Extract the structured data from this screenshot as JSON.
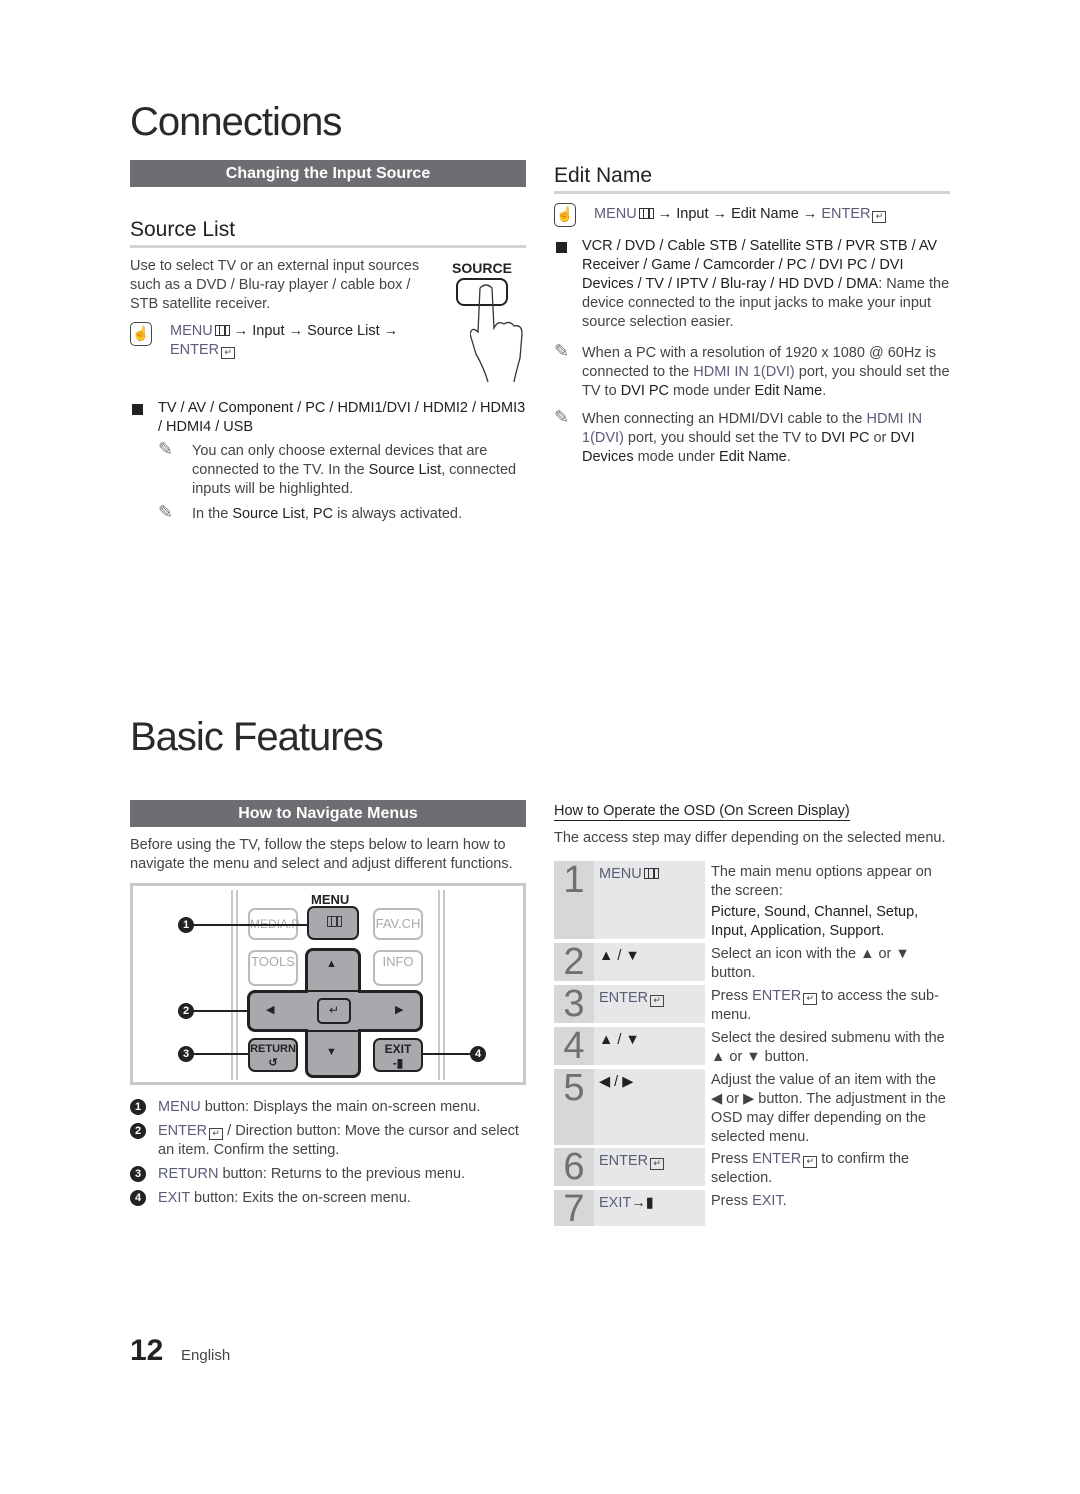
{
  "connections": {
    "title": "Connections",
    "bar_title": "Changing the Input Source",
    "source_list": {
      "heading": "Source List",
      "intro": "Use to select TV or an external input sources such as a DVD / Blu-ray player / cable box / STB satellite receiver.",
      "source_label": "SOURCE",
      "path_menu": "MENU",
      "path_rest": "→ Input → Source List →",
      "path_enter": "ENTER",
      "bullet": "TV / AV / Component / PC / HDMI1/DVI / HDMI2 / HDMI3 / HDMI4 / USB",
      "note1_a": "You can only choose external devices that are connected to the TV. In the ",
      "note1_b": "Source List",
      "note1_c": ", connected inputs will be highlighted.",
      "note2_a": "In the ",
      "note2_b": "Source List",
      "note2_c": ", ",
      "note2_d": "PC",
      "note2_e": " is always activated."
    },
    "edit_name": {
      "heading": "Edit Name",
      "path_menu": "MENU",
      "path_rest": "→ Input → Edit Name →",
      "path_enter": "ENTER",
      "bullet_bold": "VCR / DVD / Cable STB / Satellite STB / PVR STB / AV Receiver / Game / Camcorder / PC / DVI PC / DVI Devices / TV / IPTV / Blu-ray / HD DVD / DMA",
      "bullet_rest": ": Name the device connected to the input jacks to make your input source selection easier.",
      "note1_a": "When a PC with a resolution of 1920 x 1080 @ 60Hz is connected to the ",
      "note1_b": "HDMI IN 1(DVI)",
      "note1_c": " port, you should set the TV to ",
      "note1_d": "DVI PC",
      "note1_e": " mode under ",
      "note1_f": "Edit Name",
      "note1_g": ".",
      "note2_a": "When connecting an HDMI/DVI cable to the ",
      "note2_b": "HDMI IN 1(DVI)",
      "note2_c": " port, you should set the TV to ",
      "note2_d": "DVI PC",
      "note2_e": " or ",
      "note2_f": "DVI Devices",
      "note2_g": " mode under ",
      "note2_h": "Edit Name",
      "note2_i": "."
    }
  },
  "basic": {
    "title": "Basic Features",
    "bar_title": "How to Navigate Menus",
    "intro": "Before using the TV, follow the steps below to learn how to navigate the menu and select and adjust different functions.",
    "remote": {
      "menu_label": "MENU",
      "media_label": "MEDIA.P",
      "favch_label": "FAV.CH",
      "tools_label": "TOOLS",
      "info_label": "INFO",
      "return_label": "RETURN",
      "exit_label": "EXIT",
      "callouts": [
        "1",
        "2",
        "3",
        "4"
      ]
    },
    "legend": [
      {
        "num": "1",
        "key": "MENU",
        "text": " button: Displays the main on-screen menu."
      },
      {
        "num": "2",
        "key": "ENTER",
        "text": " / Direction button: Move the cursor and select an item. Confirm the setting."
      },
      {
        "num": "3",
        "key": "RETURN",
        "text": " button: Returns to the previous menu."
      },
      {
        "num": "4",
        "key": "EXIT",
        "text": " button: Exits the on-screen menu."
      }
    ],
    "osd": {
      "heading": "How to Operate the OSD (On Screen Display)",
      "note": "The access step may differ depending on the selected menu.",
      "steps": [
        {
          "num": "1",
          "key": "MENU",
          "desc": "The main menu options appear on the screen:",
          "desc_bold": "Picture, Sound, Channel, Setup, Input, Application, Support."
        },
        {
          "num": "2",
          "key": "▲ / ▼",
          "desc": "Select an icon with the ▲ or ▼ button."
        },
        {
          "num": "3",
          "key": "ENTER",
          "desc_a": "Press ",
          "desc_key": "ENTER",
          "desc_b": " to access the sub-menu."
        },
        {
          "num": "4",
          "key": "▲ / ▼",
          "desc": "Select the desired submenu with the ▲ or ▼ button."
        },
        {
          "num": "5",
          "key": "◀ / ▶",
          "desc": "Adjust the value of an item with the ◀ or ▶ button. The adjustment in the OSD may differ depending on the selected menu."
        },
        {
          "num": "6",
          "key": "ENTER",
          "desc_a": "Press ",
          "desc_key": "ENTER",
          "desc_b": " to confirm the selection."
        },
        {
          "num": "7",
          "key": "EXIT",
          "desc_a": "Press ",
          "desc_key": "EXIT",
          "desc_b": "."
        }
      ]
    }
  },
  "footer": {
    "page_number": "12",
    "language": "English"
  }
}
